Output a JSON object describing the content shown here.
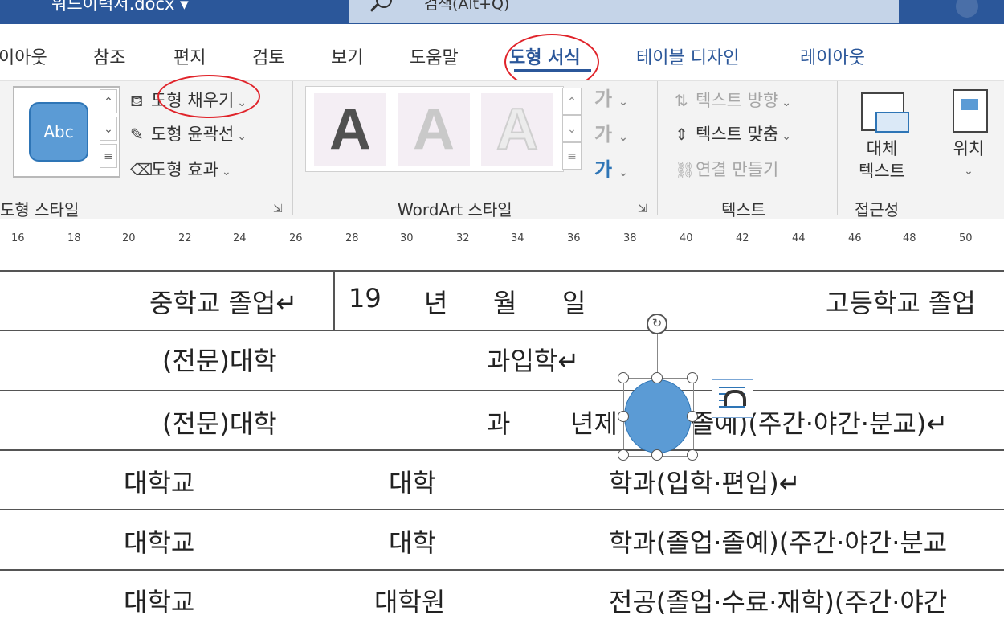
{
  "window": {
    "doc_title": "워드이력서.docx ▾",
    "search_placeholder": "검색(Alt+Q)"
  },
  "tabs": [
    {
      "label": "이아웃"
    },
    {
      "label": "참조"
    },
    {
      "label": "편지"
    },
    {
      "label": "검토"
    },
    {
      "label": "보기"
    },
    {
      "label": "도움말"
    },
    {
      "label": "도형 서식"
    },
    {
      "label": "테이블 디자인"
    },
    {
      "label": "레이아웃"
    }
  ],
  "ribbon": {
    "shape_styles": {
      "preview_text": "Abc",
      "fill": "도형 채우기",
      "outline": "도형 윤곽선",
      "effects": "도형 효과",
      "label": "도형 스타일"
    },
    "wordart": {
      "tile_letter": "A",
      "ga": "가",
      "label": "WordArt 스타일"
    },
    "text": {
      "direction": "텍스트 방향",
      "align": "텍스트 맞춤",
      "link": "연결 만들기",
      "label": "텍스트"
    },
    "accessibility": {
      "alt_text_1": "대체",
      "alt_text_2": "텍스트",
      "label": "접근성"
    },
    "arrange": {
      "position": "위치"
    }
  },
  "ruler": [
    "16",
    "18",
    "20",
    "22",
    "24",
    "26",
    "28",
    "30",
    "32",
    "34",
    "36",
    "38",
    "40",
    "42",
    "44",
    "46",
    "48",
    "50"
  ],
  "table": {
    "row1": {
      "a": "중학교 졸업↵",
      "b": "19",
      "c": "년",
      "d": "월",
      "e": "일",
      "f": "고등학교 졸업"
    },
    "row2": {
      "a": "(전문)대학",
      "b": "과입학↵"
    },
    "row3": {
      "a": "(전문)대학",
      "b": "과",
      "c": "년제",
      "d": "졸예)(주간·야간·분교)↵"
    },
    "row4": {
      "a": "대학교",
      "b": "대학",
      "c": "학과(입학·편입)↵"
    },
    "row5": {
      "a": "대학교",
      "b": "대학",
      "c": "학과(졸업·졸예)(주간·야간·분교"
    },
    "row6": {
      "a": "대학교",
      "b": "대학원",
      "c": "전공(졸업·수료·재학)(주간·야간"
    }
  }
}
